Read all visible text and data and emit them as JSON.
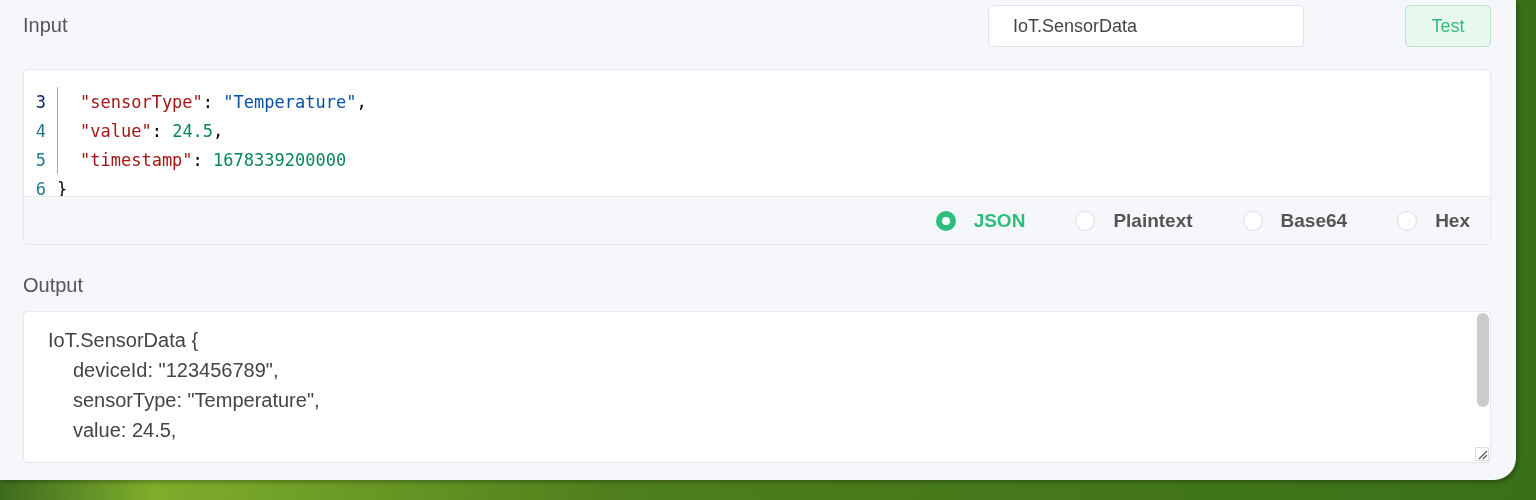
{
  "input": {
    "label": "Input",
    "type_field": {
      "value": "IoT.SensorData"
    },
    "test_button": "Test",
    "code_lines": [
      {
        "number": "3",
        "tokens": [
          {
            "kind": "key",
            "text": "\"sensorType\""
          },
          {
            "kind": "punct",
            "text": ": "
          },
          {
            "kind": "string",
            "text": "\"Temperature\""
          },
          {
            "kind": "punct",
            "text": ","
          }
        ]
      },
      {
        "number": "4",
        "tokens": [
          {
            "kind": "key",
            "text": "\"value\""
          },
          {
            "kind": "punct",
            "text": ": "
          },
          {
            "kind": "number",
            "text": "24.5"
          },
          {
            "kind": "punct",
            "text": ","
          }
        ]
      },
      {
        "number": "5",
        "tokens": [
          {
            "kind": "key",
            "text": "\"timestamp\""
          },
          {
            "kind": "punct",
            "text": ": "
          },
          {
            "kind": "number",
            "text": "1678339200000"
          }
        ]
      },
      {
        "number": "6",
        "tokens": [
          {
            "kind": "punct",
            "text": "}"
          }
        ]
      }
    ],
    "formats": [
      {
        "label": "JSON",
        "selected": true
      },
      {
        "label": "Plaintext",
        "selected": false
      },
      {
        "label": "Base64",
        "selected": false
      },
      {
        "label": "Hex",
        "selected": false
      }
    ]
  },
  "output": {
    "label": "Output",
    "header": "IoT.SensorData {",
    "fields": [
      "deviceId: \"123456789\",",
      "sensorType: \"Temperature\",",
      "value: 24.5,"
    ]
  }
}
